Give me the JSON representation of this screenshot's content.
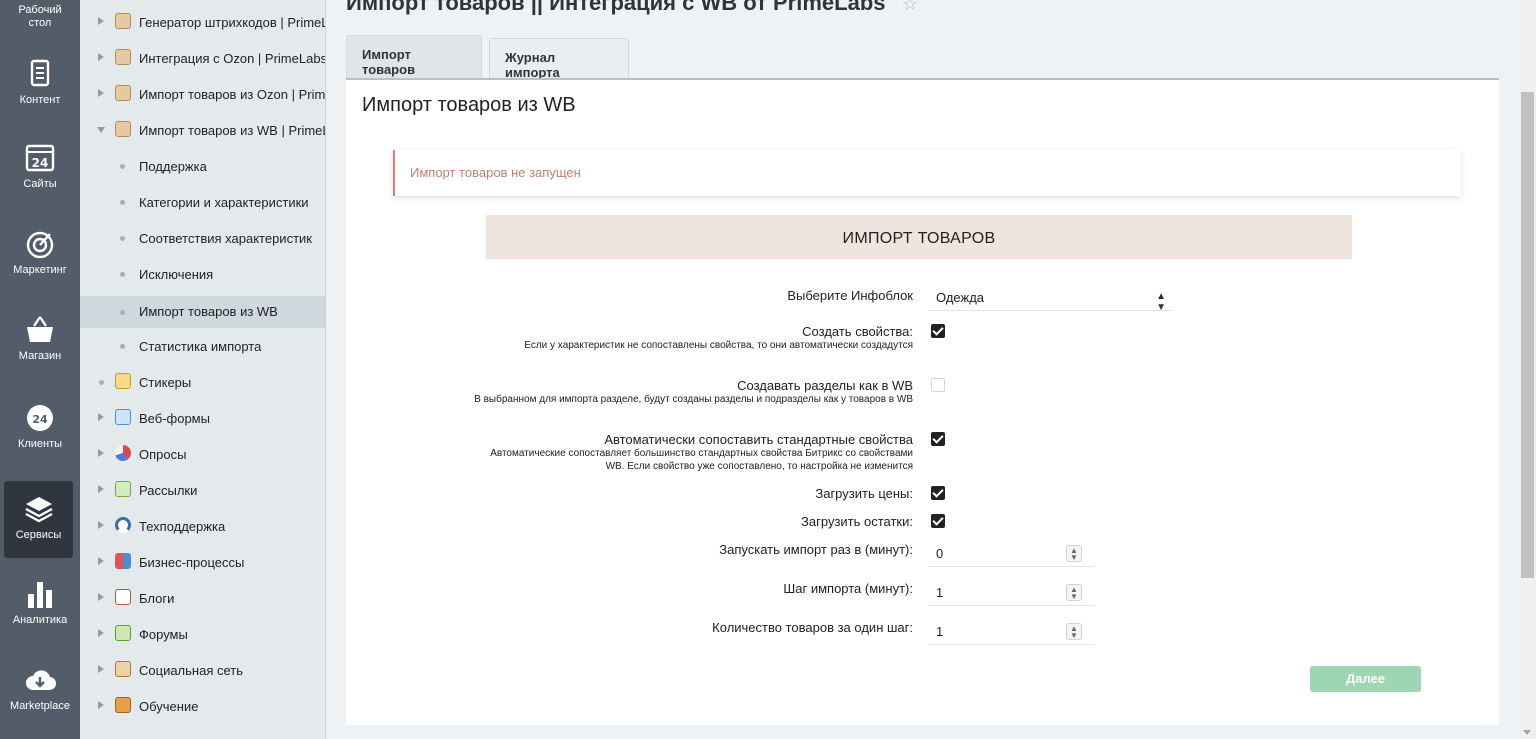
{
  "leftnav": {
    "items": [
      {
        "label": "Рабочий стол",
        "icon": "desktop-icon"
      },
      {
        "label": "Контент",
        "icon": "document-icon"
      },
      {
        "label": "Сайты",
        "icon": "calendar-24-icon"
      },
      {
        "label": "Маркетинг",
        "icon": "target-icon"
      },
      {
        "label": "Магазин",
        "icon": "basket-icon"
      },
      {
        "label": "Клиенты",
        "icon": "clients-24-icon"
      },
      {
        "label": "Сервисы",
        "icon": "layers-icon"
      },
      {
        "label": "Аналитика",
        "icon": "bar-chart-icon"
      },
      {
        "label": "Marketplace",
        "icon": "cloud-download-icon"
      }
    ]
  },
  "tree": {
    "items": [
      {
        "label": "Генератор штрихкодов | PrimeLabs"
      },
      {
        "label": "Интеграция с Ozon | PrimeLabs"
      },
      {
        "label": "Импорт товаров из Ozon | PrimeLabs"
      },
      {
        "label": "Импорт товаров из WB | PrimeLabs"
      },
      {
        "label": "Поддержка"
      },
      {
        "label": "Категории и характеристики"
      },
      {
        "label": "Соответствия характеристик"
      },
      {
        "label": "Исключения"
      },
      {
        "label": "Импорт товаров из WB"
      },
      {
        "label": "Статистика импорта"
      },
      {
        "label": "Стикеры"
      },
      {
        "label": "Веб-формы"
      },
      {
        "label": "Опросы"
      },
      {
        "label": "Рассылки"
      },
      {
        "label": "Техподдержка"
      },
      {
        "label": "Бизнес-процессы"
      },
      {
        "label": "Блоги"
      },
      {
        "label": "Форумы"
      },
      {
        "label": "Социальная сеть"
      },
      {
        "label": "Обучение"
      }
    ]
  },
  "header": {
    "title": "Импорт товаров || Интеграция с WB от PrimeLabs"
  },
  "tabs": [
    {
      "label": "Импорт товаров"
    },
    {
      "label": "Журнал импорта"
    }
  ],
  "panel": {
    "title": "Импорт товаров из WB",
    "alert": "Импорт товаров не запущен",
    "section": "ИМПОРТ ТОВАРОВ",
    "iblock_label": "Выберите Инфоблок",
    "iblock_value": "Одежда",
    "create_props_label": "Создать свойства:",
    "create_props_hint": "Если у характеристик не сопоставлены свойства, то они автоматически создадутся",
    "create_sections_label": "Создавать разделы как в WB",
    "create_sections_hint": "В выбранном для импорта разделе, будут созданы разделы и подразделы как у товаров в WB",
    "auto_match_label": "Автоматически сопоставить стандартные свойства",
    "auto_match_hint": "Автоматические сопоставляет большинство стандартных свойства Битрикс со свойствами WB. Если свойство уже сопоставлено, то настройка не изменится",
    "prices_label": "Загрузить цены:",
    "stocks_label": "Загрузить остатки:",
    "interval_label": "Запускать импорт раз в (минут):",
    "interval_value": "0",
    "step_label": "Шаг импорта (минут):",
    "step_value": "1",
    "count_label": "Количество товаров за один шаг:",
    "count_value": "1",
    "next_button": "Далее"
  }
}
